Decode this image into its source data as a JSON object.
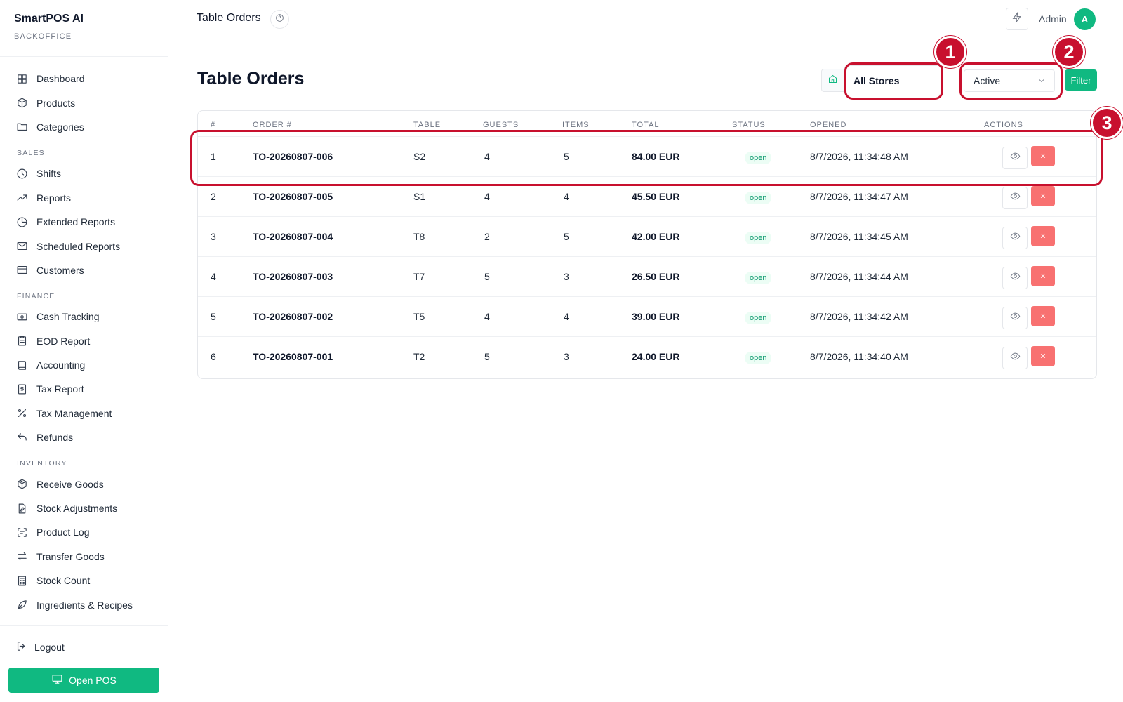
{
  "brand": {
    "title": "SmartPOS AI",
    "subtitle": "BACKOFFICE"
  },
  "sidebar": {
    "top_items": [
      {
        "label": "Dashboard",
        "icon": "dashboard-icon"
      },
      {
        "label": "Products",
        "icon": "box-icon"
      },
      {
        "label": "Categories",
        "icon": "folder-icon"
      }
    ],
    "sections": [
      {
        "title": "SALES",
        "items": [
          {
            "label": "Shifts",
            "icon": "clock-icon"
          },
          {
            "label": "Reports",
            "icon": "trend-icon"
          },
          {
            "label": "Extended Reports",
            "icon": "pie-icon"
          },
          {
            "label": "Scheduled Reports",
            "icon": "mail-icon"
          },
          {
            "label": "Customers",
            "icon": "card-icon"
          }
        ]
      },
      {
        "title": "FINANCE",
        "items": [
          {
            "label": "Cash Tracking",
            "icon": "cash-icon"
          },
          {
            "label": "EOD Report",
            "icon": "clipboard-icon"
          },
          {
            "label": "Accounting",
            "icon": "book-icon"
          },
          {
            "label": "Tax Report",
            "icon": "dollar-doc-icon"
          },
          {
            "label": "Tax Management",
            "icon": "percent-icon"
          },
          {
            "label": "Refunds",
            "icon": "undo-icon"
          }
        ]
      },
      {
        "title": "INVENTORY",
        "items": [
          {
            "label": "Receive Goods",
            "icon": "package-icon"
          },
          {
            "label": "Stock Adjustments",
            "icon": "edit-doc-icon"
          },
          {
            "label": "Product Log",
            "icon": "scan-icon"
          },
          {
            "label": "Transfer Goods",
            "icon": "transfer-icon"
          },
          {
            "label": "Stock Count",
            "icon": "calculator-icon"
          },
          {
            "label": "Ingredients & Recipes",
            "icon": "leaf-icon"
          }
        ]
      }
    ],
    "logout_label": "Logout",
    "open_pos_label": "Open POS"
  },
  "topbar": {
    "title": "Table Orders",
    "user_label": "Admin",
    "avatar_initial": "A"
  },
  "main": {
    "page_title": "Table Orders",
    "store_filter": "All Stores",
    "status_filter": "Active",
    "filter_button": "Filter"
  },
  "table": {
    "columns": [
      "#",
      "ORDER #",
      "TABLE",
      "GUESTS",
      "ITEMS",
      "TOTAL",
      "STATUS",
      "OPENED",
      "ACTIONS"
    ],
    "rows": [
      {
        "num": "1",
        "order": "TO-20260807-006",
        "table": "S2",
        "guests": "4",
        "items": "5",
        "total": "84.00 EUR",
        "status": "open",
        "opened": "8/7/2026, 11:34:48 AM"
      },
      {
        "num": "2",
        "order": "TO-20260807-005",
        "table": "S1",
        "guests": "4",
        "items": "4",
        "total": "45.50 EUR",
        "status": "open",
        "opened": "8/7/2026, 11:34:47 AM"
      },
      {
        "num": "3",
        "order": "TO-20260807-004",
        "table": "T8",
        "guests": "2",
        "items": "5",
        "total": "42.00 EUR",
        "status": "open",
        "opened": "8/7/2026, 11:34:45 AM"
      },
      {
        "num": "4",
        "order": "TO-20260807-003",
        "table": "T7",
        "guests": "5",
        "items": "3",
        "total": "26.50 EUR",
        "status": "open",
        "opened": "8/7/2026, 11:34:44 AM"
      },
      {
        "num": "5",
        "order": "TO-20260807-002",
        "table": "T5",
        "guests": "4",
        "items": "4",
        "total": "39.00 EUR",
        "status": "open",
        "opened": "8/7/2026, 11:34:42 AM"
      },
      {
        "num": "6",
        "order": "TO-20260807-001",
        "table": "T2",
        "guests": "5",
        "items": "3",
        "total": "24.00 EUR",
        "status": "open",
        "opened": "8/7/2026, 11:34:40 AM"
      }
    ]
  },
  "annotations": {
    "markers": [
      "1",
      "2",
      "3"
    ],
    "color": "#c8102e"
  },
  "colors": {
    "accent": "#10b981",
    "danger": "#f87171",
    "badge_bg": "#ecfdf5",
    "badge_text": "#059669"
  }
}
